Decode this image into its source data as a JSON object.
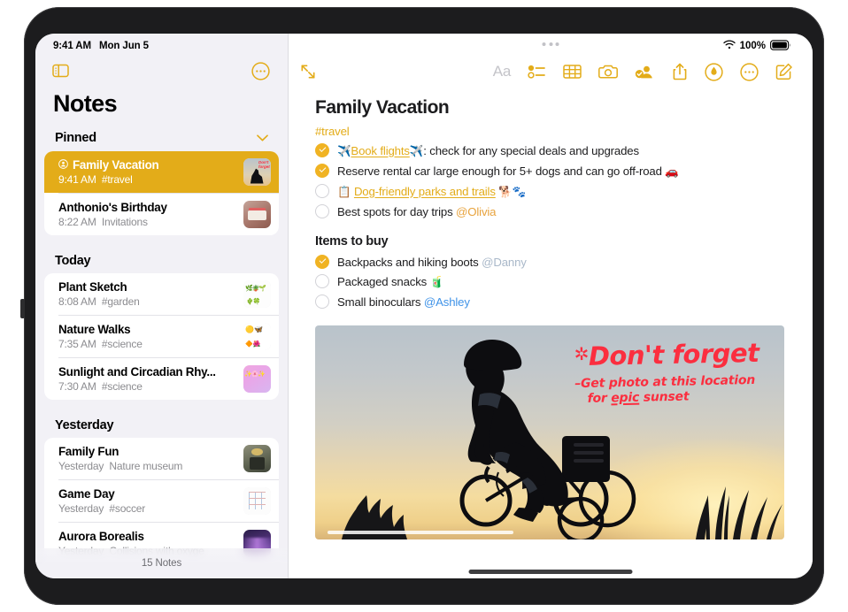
{
  "status_bar": {
    "time": "9:41 AM",
    "date": "Mon Jun 5",
    "battery_percent": "100%",
    "wifi_icon": "wifi-icon",
    "battery_icon": "battery-icon"
  },
  "sidebar": {
    "title": "Notes",
    "toolbar": {
      "sidebar_toggle_icon": "sidebar-toggle-icon",
      "more_icon": "more-circle-icon"
    },
    "footer_count": "15 Notes",
    "sections": [
      {
        "header": "Pinned",
        "collapsible": true,
        "chevron_icon": "chevron-down-icon",
        "items": [
          {
            "title": "Family Vacation",
            "time": "9:41 AM",
            "subtitle": "#travel",
            "selected": true,
            "shared_icon": "shared-person-icon",
            "thumb": "bike-sunset-thumb"
          },
          {
            "title": "Anthonio's Birthday",
            "time": "8:22 AM",
            "subtitle": "Invitations",
            "selected": false,
            "shared_icon": "",
            "thumb": "birthday-cake-thumb"
          }
        ]
      },
      {
        "header": "Today",
        "collapsible": false,
        "chevron_icon": "",
        "items": [
          {
            "title": "Plant Sketch",
            "time": "8:08 AM",
            "subtitle": "#garden",
            "selected": false,
            "shared_icon": "",
            "thumb": "plant-sketch-thumb"
          },
          {
            "title": "Nature Walks",
            "time": "7:35 AM",
            "subtitle": "#science",
            "selected": false,
            "shared_icon": "",
            "thumb": "nature-walks-thumb"
          },
          {
            "title": "Sunlight and Circadian Rhy...",
            "time": "7:30 AM",
            "subtitle": "#science",
            "selected": false,
            "shared_icon": "",
            "thumb": "sunlight-thumb"
          }
        ]
      },
      {
        "header": "Yesterday",
        "collapsible": false,
        "chevron_icon": "",
        "items": [
          {
            "title": "Family Fun",
            "time": "Yesterday",
            "subtitle": "Nature museum",
            "selected": false,
            "shared_icon": "",
            "thumb": "museum-thumb"
          },
          {
            "title": "Game Day",
            "time": "Yesterday",
            "subtitle": "#soccer",
            "selected": false,
            "shared_icon": "",
            "thumb": "game-day-thumb"
          },
          {
            "title": "Aurora Borealis",
            "time": "Yesterday",
            "subtitle": "Collisions with oxyge",
            "selected": false,
            "shared_icon": "",
            "thumb": "aurora-thumb"
          }
        ]
      }
    ]
  },
  "detail": {
    "drag_handle_icon": "multitask-handle-icon",
    "toolbar": {
      "expand_icon": "expand-diagonal-icon",
      "format_label": "Aa",
      "checklist_icon": "checklist-icon",
      "table_icon": "table-icon",
      "camera_icon": "camera-icon",
      "collaborate_icon": "add-person-icon",
      "share_icon": "share-icon",
      "markup_icon": "markup-pen-icon",
      "more_icon": "more-circle-icon",
      "compose_icon": "compose-icon"
    },
    "note": {
      "title": "Family Vacation",
      "tag": "#travel",
      "checklist": [
        {
          "checked": true,
          "emoji_lead": "✈️",
          "link_text": "Book flights",
          "emoji_trail": "✈️",
          "rest": ": check for any special deals and upgrades",
          "mention": "",
          "trailing_emoji": ""
        },
        {
          "checked": true,
          "emoji_lead": "",
          "link_text": "",
          "emoji_trail": "",
          "rest": "Reserve rental car large enough for 5+ dogs and can go off-road",
          "mention": "",
          "trailing_emoji": "🚗"
        },
        {
          "checked": false,
          "emoji_lead": "📋",
          "link_text": "Dog-friendly parks and trails",
          "emoji_trail": "",
          "rest": "",
          "mention": "",
          "trailing_emoji": "🐕🐾"
        },
        {
          "checked": false,
          "emoji_lead": "",
          "link_text": "",
          "emoji_trail": "",
          "rest": "Best spots for day trips",
          "mention": "@Olivia",
          "trailing_emoji": ""
        }
      ],
      "section2_heading": "Items to buy",
      "checklist2": [
        {
          "checked": true,
          "rest": "Backpacks and hiking boots",
          "mention": "@Danny",
          "trailing_emoji": ""
        },
        {
          "checked": false,
          "rest": "Packaged snacks",
          "mention": "",
          "trailing_emoji": "🧃"
        },
        {
          "checked": false,
          "rest": "Small binoculars",
          "mention": "@Ashley",
          "trailing_emoji": ""
        }
      ],
      "photo": {
        "alt_name": "cyclist-sunset-photo",
        "handwriting_line1": "Don't forget",
        "handwriting_star": "✲",
        "handwriting_line2": "–Get photo at this location",
        "handwriting_line3_pre": "for ",
        "handwriting_line3_underlined": "epic",
        "handwriting_line3_post": " sunset"
      }
    }
  },
  "colors": {
    "accent_yellow": "#e3ac19",
    "check_fill": "#f0b323",
    "selected_row": "#e3ac19",
    "mention_blue": "#3f93e8",
    "mention_gray_blue": "#a9b8c9",
    "mention_warm": "#e8a33d",
    "handwriting_red": "#fb2e3f",
    "sidebar_bg": "#f2f1f6"
  }
}
